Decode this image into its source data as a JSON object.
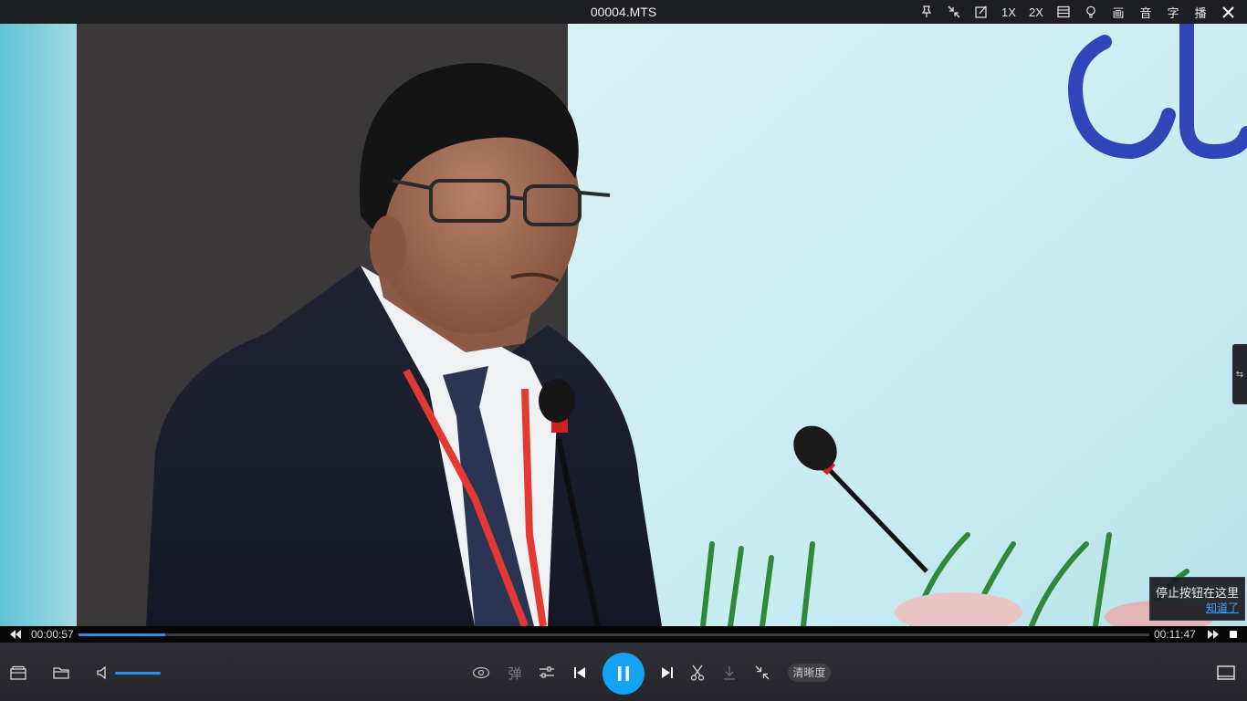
{
  "window": {
    "title": "00004.MTS",
    "buttons": {
      "speed_1x": "1X",
      "speed_2x": "2X",
      "picture": "画",
      "audio": "音",
      "subtitle": "字",
      "play": "播"
    }
  },
  "player": {
    "current_time": "00:00:57",
    "total_time": "00:11:47",
    "progress_fraction": 0.081,
    "volume_fraction": 1.0,
    "danmu_label": "弹",
    "quality_label": "清晰度",
    "side_toggle_label": "⇆"
  },
  "tooltip": {
    "text": "停止按钮在这里",
    "link": "知道了"
  },
  "video_overlay_text": "QU",
  "colors": {
    "accent": "#17a3f5",
    "progress": "#2d8ee6",
    "titlebar": "#1d1e22",
    "controlbar": "#2b2c31"
  },
  "icons": {
    "pin": "pin-icon",
    "mini": "shrink-icon",
    "note": "edit-icon",
    "layout": "layout-icon",
    "bulb": "bulb-icon",
    "close": "close-icon"
  }
}
